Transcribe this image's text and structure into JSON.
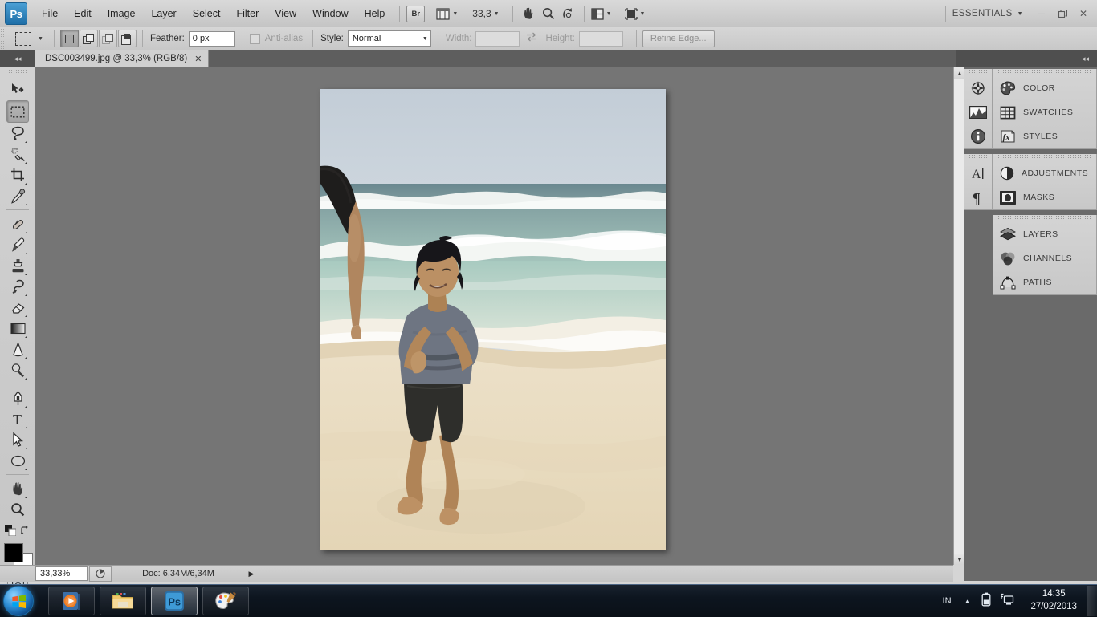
{
  "app": {
    "logo": "Ps",
    "workspace": "ESSENTIALS",
    "menu": [
      "File",
      "Edit",
      "Image",
      "Layer",
      "Select",
      "Filter",
      "View",
      "Window",
      "Help"
    ],
    "bridge_label": "Br",
    "zoom_level": "33,3",
    "window_buttons": {
      "minimize": "─",
      "restore": "❐",
      "close": "✕"
    }
  },
  "options_bar": {
    "feather_label": "Feather:",
    "feather_value": "0 px",
    "antialias_label": "Anti-alias",
    "style_label": "Style:",
    "style_value": "Normal",
    "width_label": "Width:",
    "width_value": "",
    "height_label": "Height:",
    "height_value": "",
    "refine_edge_label": "Refine Edge..."
  },
  "document": {
    "tab_title": "DSC003499.jpg @ 33,3% (RGB/8)",
    "close_glyph": "✕"
  },
  "status_bar": {
    "zoom": "33,33%",
    "doc_info": "Doc: 6,34M/6,34M",
    "arrow": "▶"
  },
  "toolbar": {
    "tools": [
      {
        "name": "move-tool",
        "selected": false,
        "has_more": false
      },
      {
        "name": "rectangular-marquee-tool",
        "selected": true,
        "has_more": true
      },
      {
        "name": "lasso-tool",
        "selected": false,
        "has_more": true
      },
      {
        "name": "quick-selection-tool",
        "selected": false,
        "has_more": true
      },
      {
        "name": "crop-tool",
        "selected": false,
        "has_more": true
      },
      {
        "name": "eyedropper-tool",
        "selected": false,
        "has_more": true
      },
      {
        "name": "spot-healing-brush-tool",
        "selected": false,
        "has_more": true
      },
      {
        "name": "brush-tool",
        "selected": false,
        "has_more": true
      },
      {
        "name": "clone-stamp-tool",
        "selected": false,
        "has_more": true
      },
      {
        "name": "history-brush-tool",
        "selected": false,
        "has_more": true
      },
      {
        "name": "eraser-tool",
        "selected": false,
        "has_more": true
      },
      {
        "name": "gradient-tool",
        "selected": false,
        "has_more": true
      },
      {
        "name": "blur-tool",
        "selected": false,
        "has_more": true
      },
      {
        "name": "dodge-tool",
        "selected": false,
        "has_more": true
      },
      {
        "name": "pen-tool",
        "selected": false,
        "has_more": true
      },
      {
        "name": "horizontal-type-tool",
        "selected": false,
        "has_more": true
      },
      {
        "name": "path-selection-tool",
        "selected": false,
        "has_more": true
      },
      {
        "name": "ellipse-shape-tool",
        "selected": false,
        "has_more": true
      },
      {
        "name": "hand-tool",
        "selected": false,
        "has_more": true
      },
      {
        "name": "zoom-tool",
        "selected": false,
        "has_more": false
      }
    ],
    "foreground_color": "#000000",
    "background_color": "#ffffff"
  },
  "panels": {
    "icon_groups": [
      {
        "icons": [
          "navigator-icon",
          "histogram-icon",
          "info-icon"
        ]
      },
      {
        "icons": [
          "character-icon",
          "paragraph-icon"
        ]
      }
    ],
    "groups": [
      {
        "items": [
          {
            "label": "COLOR",
            "icon": "palette-icon"
          },
          {
            "label": "SWATCHES",
            "icon": "swatches-grid-icon"
          },
          {
            "label": "STYLES",
            "icon": "fx-icon"
          }
        ]
      },
      {
        "items": [
          {
            "label": "ADJUSTMENTS",
            "icon": "half-circle-icon"
          },
          {
            "label": "MASKS",
            "icon": "mask-icon"
          }
        ]
      },
      {
        "items": [
          {
            "label": "LAYERS",
            "icon": "layers-stack-icon"
          },
          {
            "label": "CHANNELS",
            "icon": "channels-circles-icon"
          },
          {
            "label": "PATHS",
            "icon": "paths-anchor-icon"
          }
        ]
      }
    ],
    "collapse_glyph": "◂◂"
  },
  "taskbar": {
    "start_label": "Start",
    "items": [
      {
        "name": "windows-media-player",
        "active": false
      },
      {
        "name": "windows-explorer",
        "active": false
      },
      {
        "name": "adobe-photoshop",
        "active": true
      },
      {
        "name": "paint",
        "active": false
      }
    ],
    "tray": {
      "language": "IN",
      "show_hidden_glyph": "▲",
      "battery_icon": "battery-icon",
      "network_icon": "network-icon",
      "time": "14:35",
      "date": "27/02/2013"
    }
  },
  "photo": {
    "alt": "Young person walking on a sunny beach with ocean waves behind",
    "colors": {
      "sky_top": "#c4ced8",
      "sky_bottom": "#ccd4dc",
      "sea_far": "#6d8a93",
      "sea_mid": "#87a5a5",
      "sea_near": "#9dc3bb",
      "foam": "#f2f3f0",
      "sand": "#e9dcc2",
      "sand_wet": "#ddccb0",
      "shirt": "#6e7582",
      "shorts": "#2f2f2d",
      "skin": "#b98f6c",
      "hair": "#17161a"
    }
  }
}
